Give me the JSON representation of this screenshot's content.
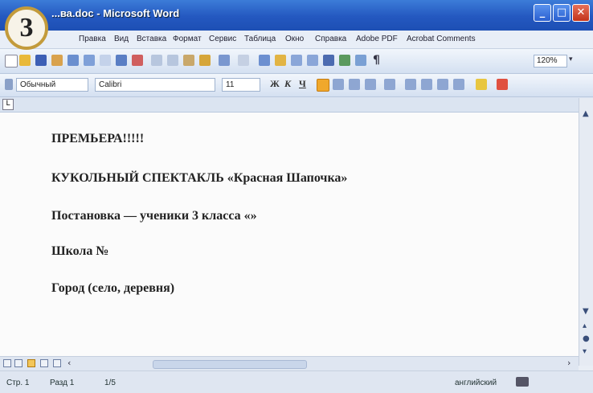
{
  "badge_number": "3",
  "window": {
    "title": "...ва.doc - Microsoft Word"
  },
  "window_buttons": {
    "minimize": "_",
    "maximize": "□",
    "close": "✕"
  },
  "menu": [
    "Правка",
    "Вид",
    "Вставка",
    "Формат",
    "Сервис",
    "Таблица",
    "Окно",
    "Справка",
    "Adobe PDF",
    "Acrobat Comments"
  ],
  "toolbar": {
    "zoom": "120%",
    "paragraph_mark": "¶"
  },
  "format_toolbar": {
    "style": "Обычный",
    "font": "Calibri",
    "size": "11",
    "bold": "Ж",
    "italic": "К",
    "underline": "Ч"
  },
  "ruler_button": "L",
  "document": {
    "paragraphs": [
      "ПРЕМЬЕРА!!!!!",
      "КУКОЛЬНЫЙ СПЕКТАКЛЬ «Красная Шапочка»",
      "Постановка — ученики 3 класса «»",
      "Школа №",
      "Город (село, деревня)"
    ]
  },
  "status_bar": {
    "page": "Стр. 1",
    "section": "Разд 1",
    "pages": "1/5",
    "language": "английский"
  }
}
